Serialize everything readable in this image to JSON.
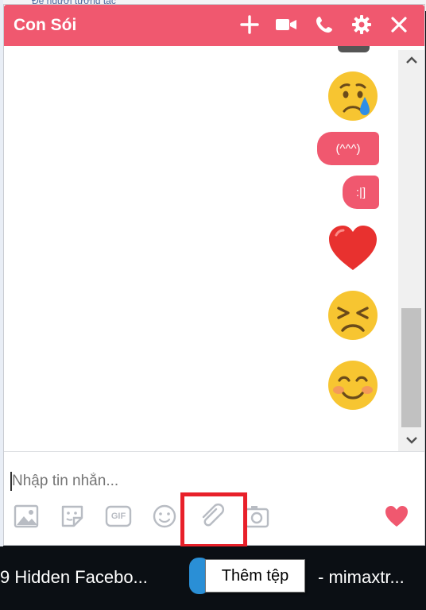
{
  "background": {
    "partial_header_text": "Đề người tương tác"
  },
  "chat": {
    "title": "Con Sói",
    "header_icons": [
      "plus-icon",
      "video-call-icon",
      "phone-icon",
      "gear-icon",
      "close-icon"
    ],
    "accent_color": "#f0586f",
    "messages": [
      {
        "type": "emoji",
        "icon": "crying-face-emoji"
      },
      {
        "type": "text",
        "text": "(^^^)"
      },
      {
        "type": "text",
        "text": ":|]"
      },
      {
        "type": "emoji",
        "icon": "red-heart-emoji"
      },
      {
        "type": "emoji",
        "icon": "tired-face-emoji"
      },
      {
        "type": "emoji",
        "icon": "blushing-smile-emoji"
      }
    ],
    "input": {
      "placeholder": "Nhập tin nhắn...",
      "value": ""
    },
    "toolbar": [
      "image-icon",
      "sticker-icon",
      "gif-icon",
      "emoji-icon",
      "paperclip-icon",
      "camera-icon",
      "heart-like-icon"
    ],
    "gif_label": "GIF"
  },
  "taskbar": {
    "item1": "9 Hidden Facebo...",
    "item2": "- mimaxtr...",
    "tooltip": "Thêm tệp"
  }
}
